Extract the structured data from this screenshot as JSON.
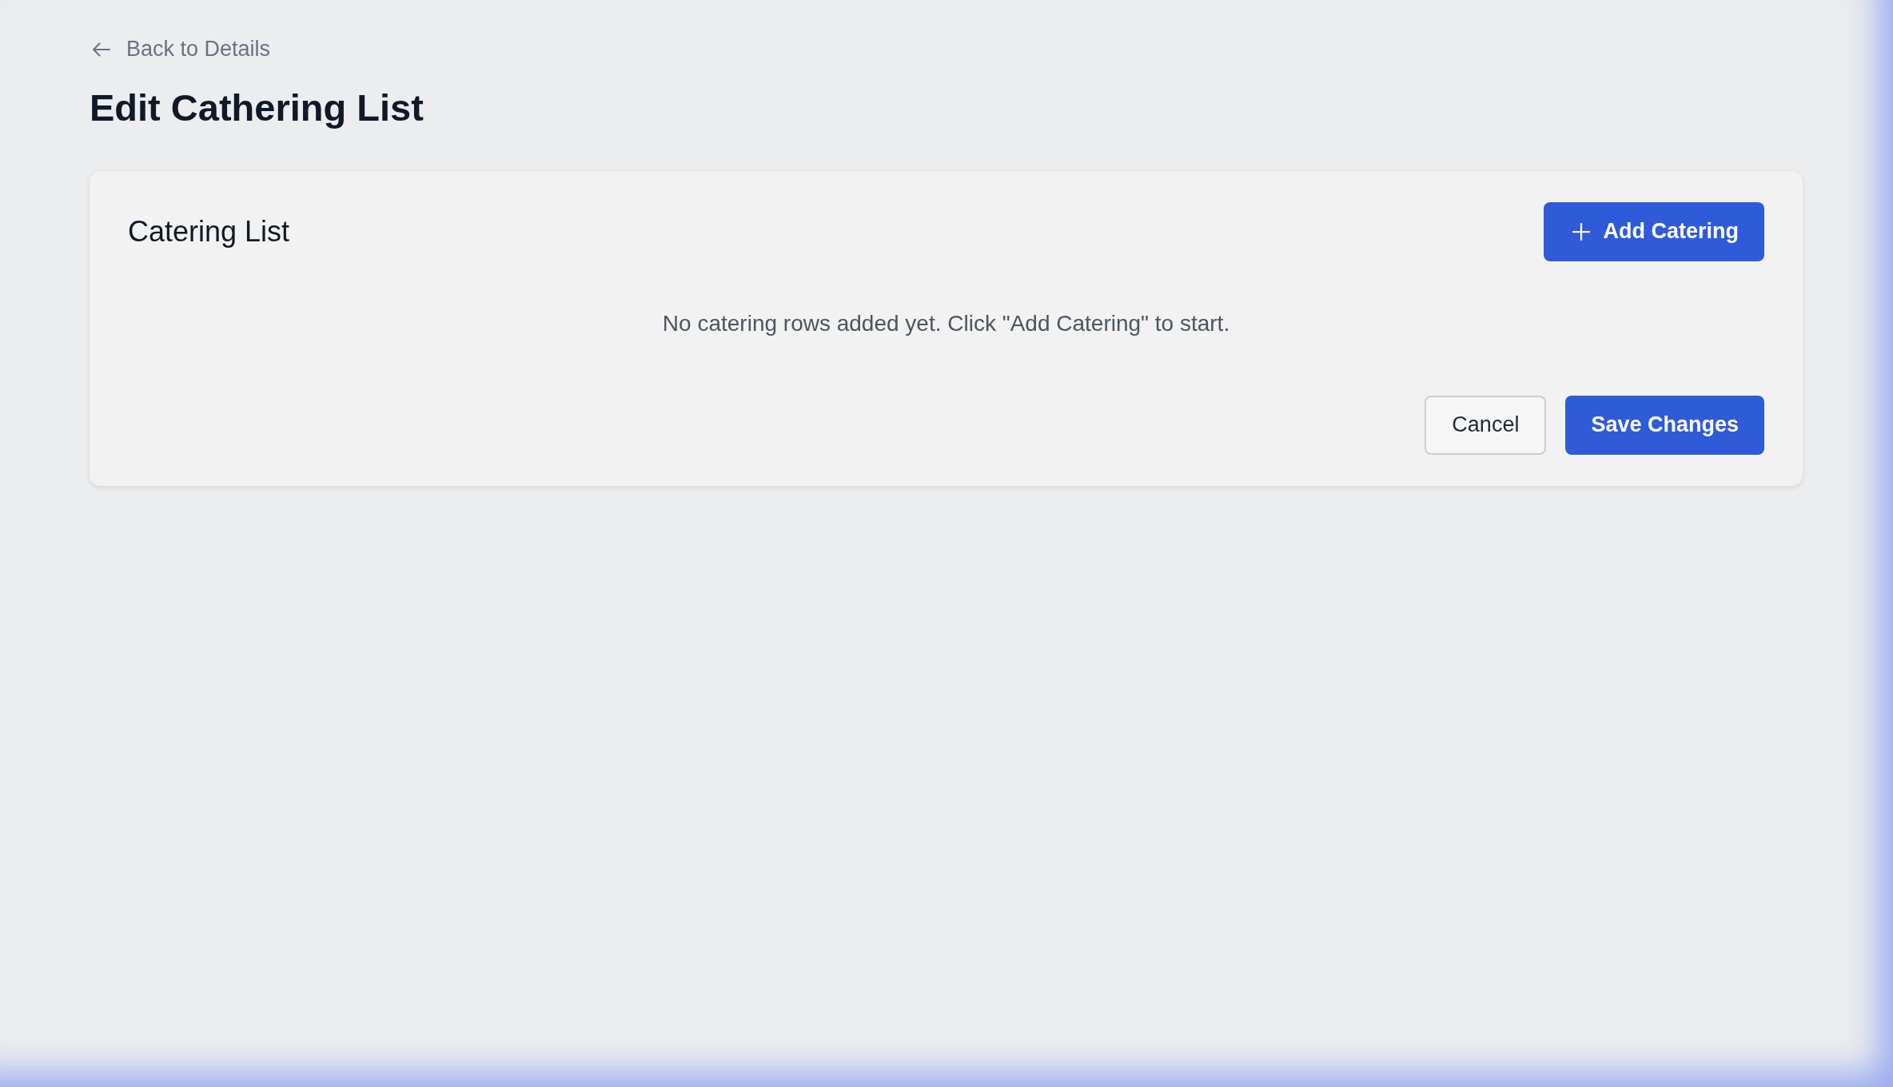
{
  "back_link": {
    "label": "Back to Details"
  },
  "page_title": "Edit Cathering List",
  "card": {
    "title": "Catering List",
    "add_button": {
      "label": "Add Catering"
    },
    "empty_message": "No catering rows added yet. Click \"Add Catering\" to start."
  },
  "buttons": [
    {
      "label": "Cancel",
      "kind": "secondary"
    },
    {
      "label": "Save Changes",
      "kind": "primary"
    }
  ]
}
